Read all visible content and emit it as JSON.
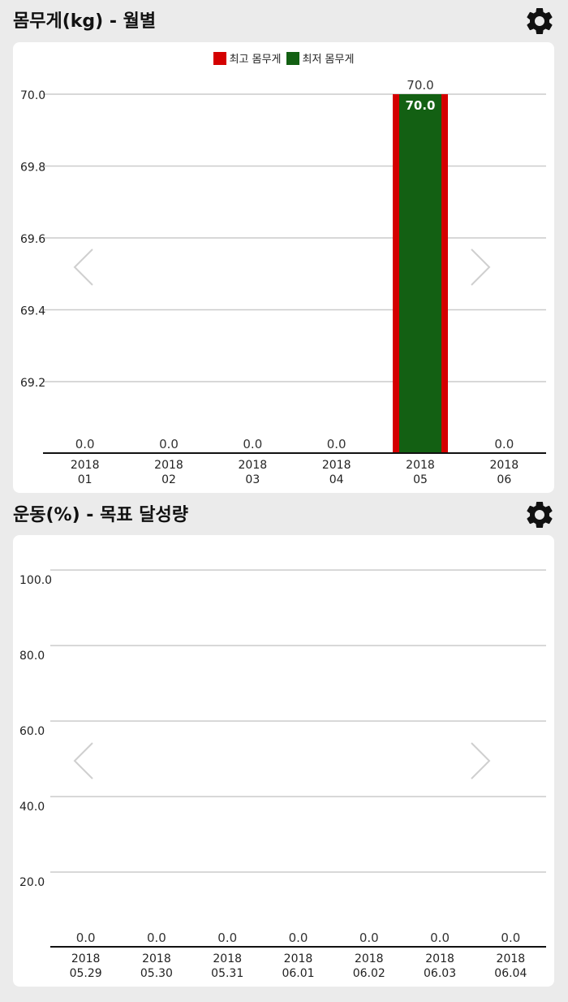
{
  "weight": {
    "title": "몸무게(kg) - 월별",
    "settings_icon": "gear-icon",
    "colors": {
      "max": "#d40000",
      "min": "#136013",
      "axis": "#111111",
      "grid": "#cccccc"
    },
    "chart_data": {
      "type": "bar",
      "categories": [
        [
          "2018",
          "01"
        ],
        [
          "2018",
          "02"
        ],
        [
          "2018",
          "03"
        ],
        [
          "2018",
          "04"
        ],
        [
          "2018",
          "05"
        ],
        [
          "2018",
          "06"
        ]
      ],
      "series": [
        {
          "name": "최고 몸무게",
          "values": [
            0.0,
            0.0,
            0.0,
            0.0,
            70.0,
            0.0
          ]
        },
        {
          "name": "최저 몸무게",
          "values": [
            0.0,
            0.0,
            0.0,
            0.0,
            70.0,
            0.0
          ]
        }
      ],
      "value_labels": [
        "0.0",
        "0.0",
        "0.0",
        "0.0",
        "70.0",
        "0.0"
      ],
      "inner_label": "70.0",
      "yticks": [
        "70.0",
        "69.8",
        "69.6",
        "69.4",
        "69.2"
      ],
      "ylim": [
        69.0,
        70.0
      ],
      "grid": true,
      "legend": "top-center"
    }
  },
  "exercise": {
    "title": "운동(%) - 목표 달성량",
    "settings_icon": "gear-icon",
    "colors": {
      "axis": "#111111",
      "grid": "#cccccc"
    },
    "chart_data": {
      "type": "bar",
      "categories": [
        [
          "2018",
          "05.29"
        ],
        [
          "2018",
          "05.30"
        ],
        [
          "2018",
          "05.31"
        ],
        [
          "2018",
          "06.01"
        ],
        [
          "2018",
          "06.02"
        ],
        [
          "2018",
          "06.03"
        ],
        [
          "2018",
          "06.04"
        ]
      ],
      "series": [
        {
          "values": [
            0.0,
            0.0,
            0.0,
            0.0,
            0.0,
            0.0,
            0.0
          ]
        }
      ],
      "value_labels": [
        "0.0",
        "0.0",
        "0.0",
        "0.0",
        "0.0",
        "0.0",
        "0.0"
      ],
      "yticks": [
        "100.0",
        "80.0",
        "60.0",
        "40.0",
        "20.0"
      ],
      "ylim": [
        0,
        100
      ],
      "grid": true
    }
  }
}
